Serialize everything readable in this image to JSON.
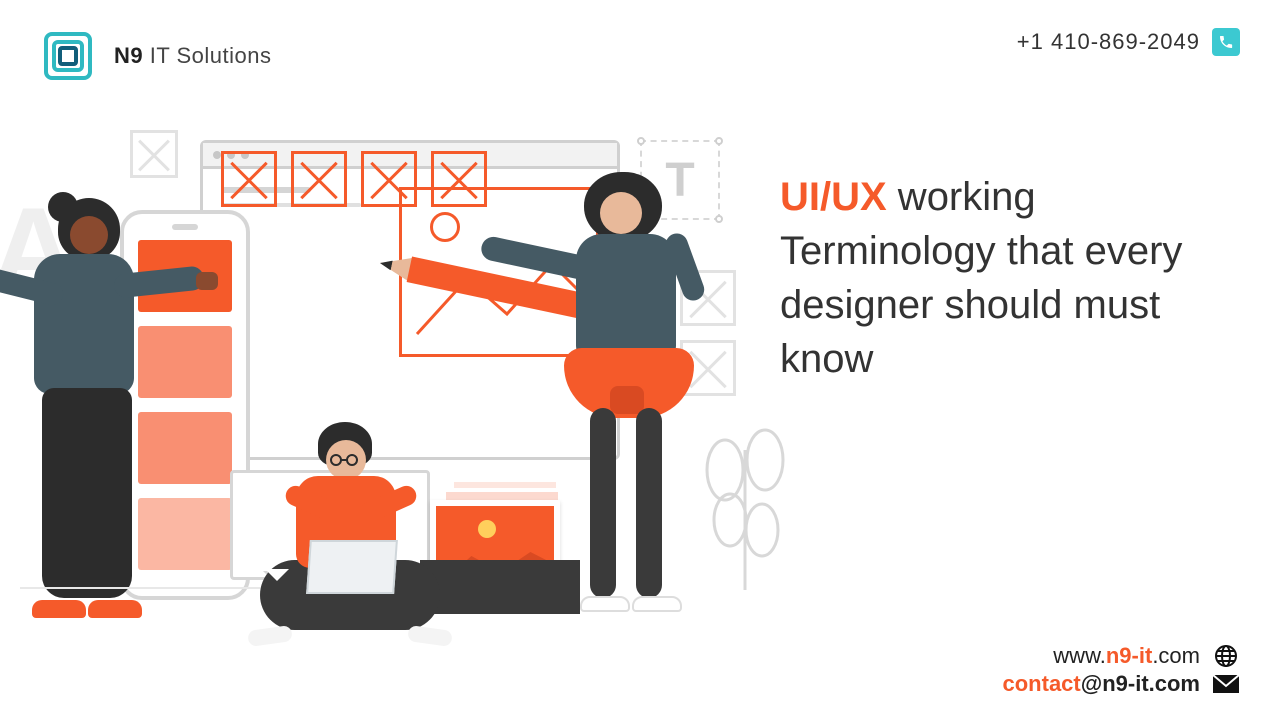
{
  "brand": {
    "name_bold": "N9",
    "name_rest": " IT Solutions"
  },
  "contact": {
    "phone": "+1 410-869-2049",
    "website_prefix": "www.",
    "website_mid": "n9-it",
    "website_suffix": ".com",
    "email_user": "contact",
    "email_at": "@n9-it.com"
  },
  "headline": {
    "accent": "UI/UX",
    "rest": " working Terminology that every designer should must know"
  },
  "decor": {
    "watermark_letter": "A",
    "text_tool_letter": "T"
  }
}
